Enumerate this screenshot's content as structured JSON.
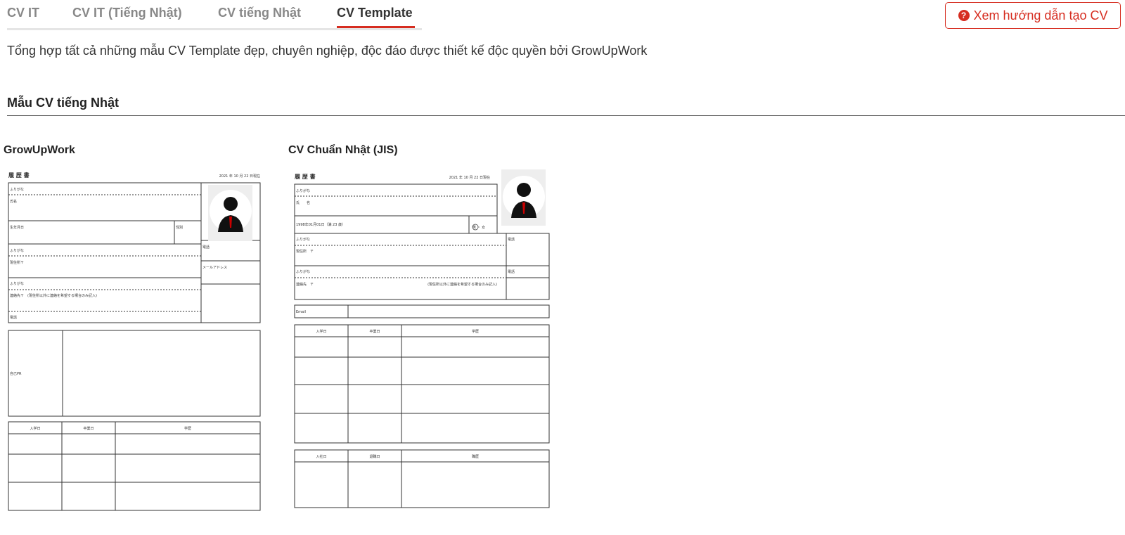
{
  "tabs": [
    {
      "label": "CV IT",
      "active": false
    },
    {
      "label": "CV IT (Tiếng Nhật)",
      "active": false
    },
    {
      "label": "CV tiếng Nhật",
      "active": false
    },
    {
      "label": "CV Template",
      "active": true
    }
  ],
  "guide_button": {
    "label": "Xem hướng dẫn tạo CV",
    "icon": "question-circle-icon"
  },
  "intro_text": "Tổng hợp tất cả những mẫu CV Template đẹp, chuyên nghiệp, độc đáo được thiết kế độc quyền bởi GrowUpWork",
  "section": {
    "title": "Mẫu CV tiếng Nhật"
  },
  "templates": [
    {
      "name": "GrowUpWork",
      "doc": {
        "title": "履 歴 書",
        "date": "2021 年 10 月 22 日現在",
        "furigana": "ふりがな",
        "name_label": "氏名",
        "birth_label": "生年月日",
        "gender_label": "性別",
        "address_label": "現住所〒",
        "phone_label": "電話",
        "email_label": "メールアドレス",
        "contact_label": "連絡先〒　(現住所以外に連絡を希望する場合のみ記入)",
        "pr_label": "自己PR",
        "enroll_label": "入学日",
        "grad_label": "卒業日",
        "edu_label": "学歴"
      }
    },
    {
      "name": "CV Chuẩn Nhật (JIS)",
      "doc": {
        "title": "履 歴 書",
        "date": "2021 年 10 月 22 日現在",
        "furigana": "ふりがな",
        "name_label": "氏　　名",
        "birth_value": "1998年01月01日（満 23 歳）",
        "gender_value": "男 ・ 女",
        "address_label": "現住所　〒",
        "phone_label": "電話",
        "contact_label": "連絡先　〒",
        "contact_note": "(現住所以外に連絡を希望する場合のみ記入)",
        "email_label": "Email",
        "enroll_label": "入学日",
        "grad_label": "卒業日",
        "edu_label": "学歴",
        "join_label": "入社日",
        "leave_label": "退職日",
        "work_label": "職歴"
      }
    }
  ]
}
